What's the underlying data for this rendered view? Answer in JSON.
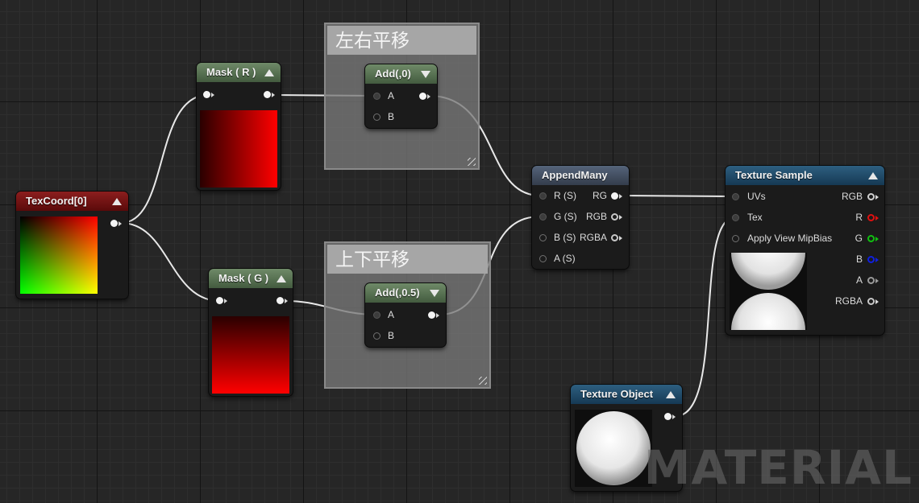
{
  "comments": {
    "horizontal_shift": "左右平移",
    "vertical_shift": "上下平移"
  },
  "nodes": {
    "texcoord": {
      "title": "TexCoord[0]"
    },
    "mask_r": {
      "title": "Mask ( R )"
    },
    "mask_g": {
      "title": "Mask ( G )"
    },
    "add_0": {
      "title": "Add(,0)",
      "pin_a": "A",
      "pin_b": "B"
    },
    "add_05": {
      "title": "Add(,0.5)",
      "pin_a": "A",
      "pin_b": "B"
    },
    "append_many": {
      "title": "AppendMany",
      "inputs": [
        "R (S)",
        "G (S)",
        "B (S)",
        "A (S)"
      ],
      "outputs": [
        "RG",
        "RGB",
        "RGBA"
      ]
    },
    "texture_sample": {
      "title": "Texture Sample",
      "inputs": [
        "UVs",
        "Tex",
        "Apply View MipBias"
      ],
      "outputs": [
        "RGB",
        "R",
        "G",
        "B",
        "A",
        "RGBA"
      ],
      "output_colors": [
        "#d0d0d0",
        "#e01010",
        "#10c010",
        "#1020e0",
        "#c8c8c8",
        "#d0d0d0"
      ]
    },
    "texture_object": {
      "title": "Texture Object"
    }
  },
  "watermark": "MATERIAL"
}
